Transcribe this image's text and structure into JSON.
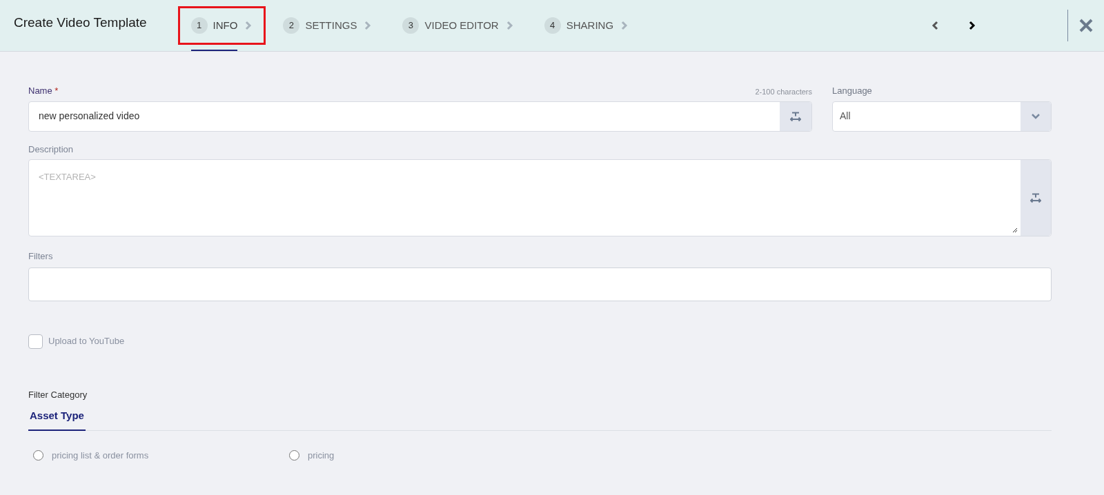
{
  "header": {
    "title": "Create Video Template",
    "steps": [
      {
        "number": "1",
        "label": "INFO",
        "selected": true,
        "highlighted": true
      },
      {
        "number": "2",
        "label": "SETTINGS",
        "selected": false,
        "highlighted": false
      },
      {
        "number": "3",
        "label": "VIDEO EDITOR",
        "selected": false,
        "highlighted": false
      },
      {
        "number": "4",
        "label": "SHARING",
        "selected": false,
        "highlighted": false
      }
    ],
    "prev_disabled": true,
    "next_disabled": false
  },
  "name_field": {
    "label": "Name",
    "required_mark": "*",
    "hint": "2-100 characters",
    "value": "new personalized video"
  },
  "language_field": {
    "label": "Language",
    "value": "All"
  },
  "description_field": {
    "label": "Description",
    "placeholder": "<TEXTAREA>"
  },
  "filters_field": {
    "label": "Filters"
  },
  "upload_checkbox": {
    "label": "Upload to YouTube",
    "checked": false
  },
  "filter_category": {
    "title": "Filter Category",
    "tabs": [
      {
        "label": "Asset Type",
        "selected": true
      }
    ],
    "options": [
      {
        "label": "pricing list & order forms",
        "selected": false
      },
      {
        "label": "pricing",
        "selected": false
      }
    ]
  }
}
